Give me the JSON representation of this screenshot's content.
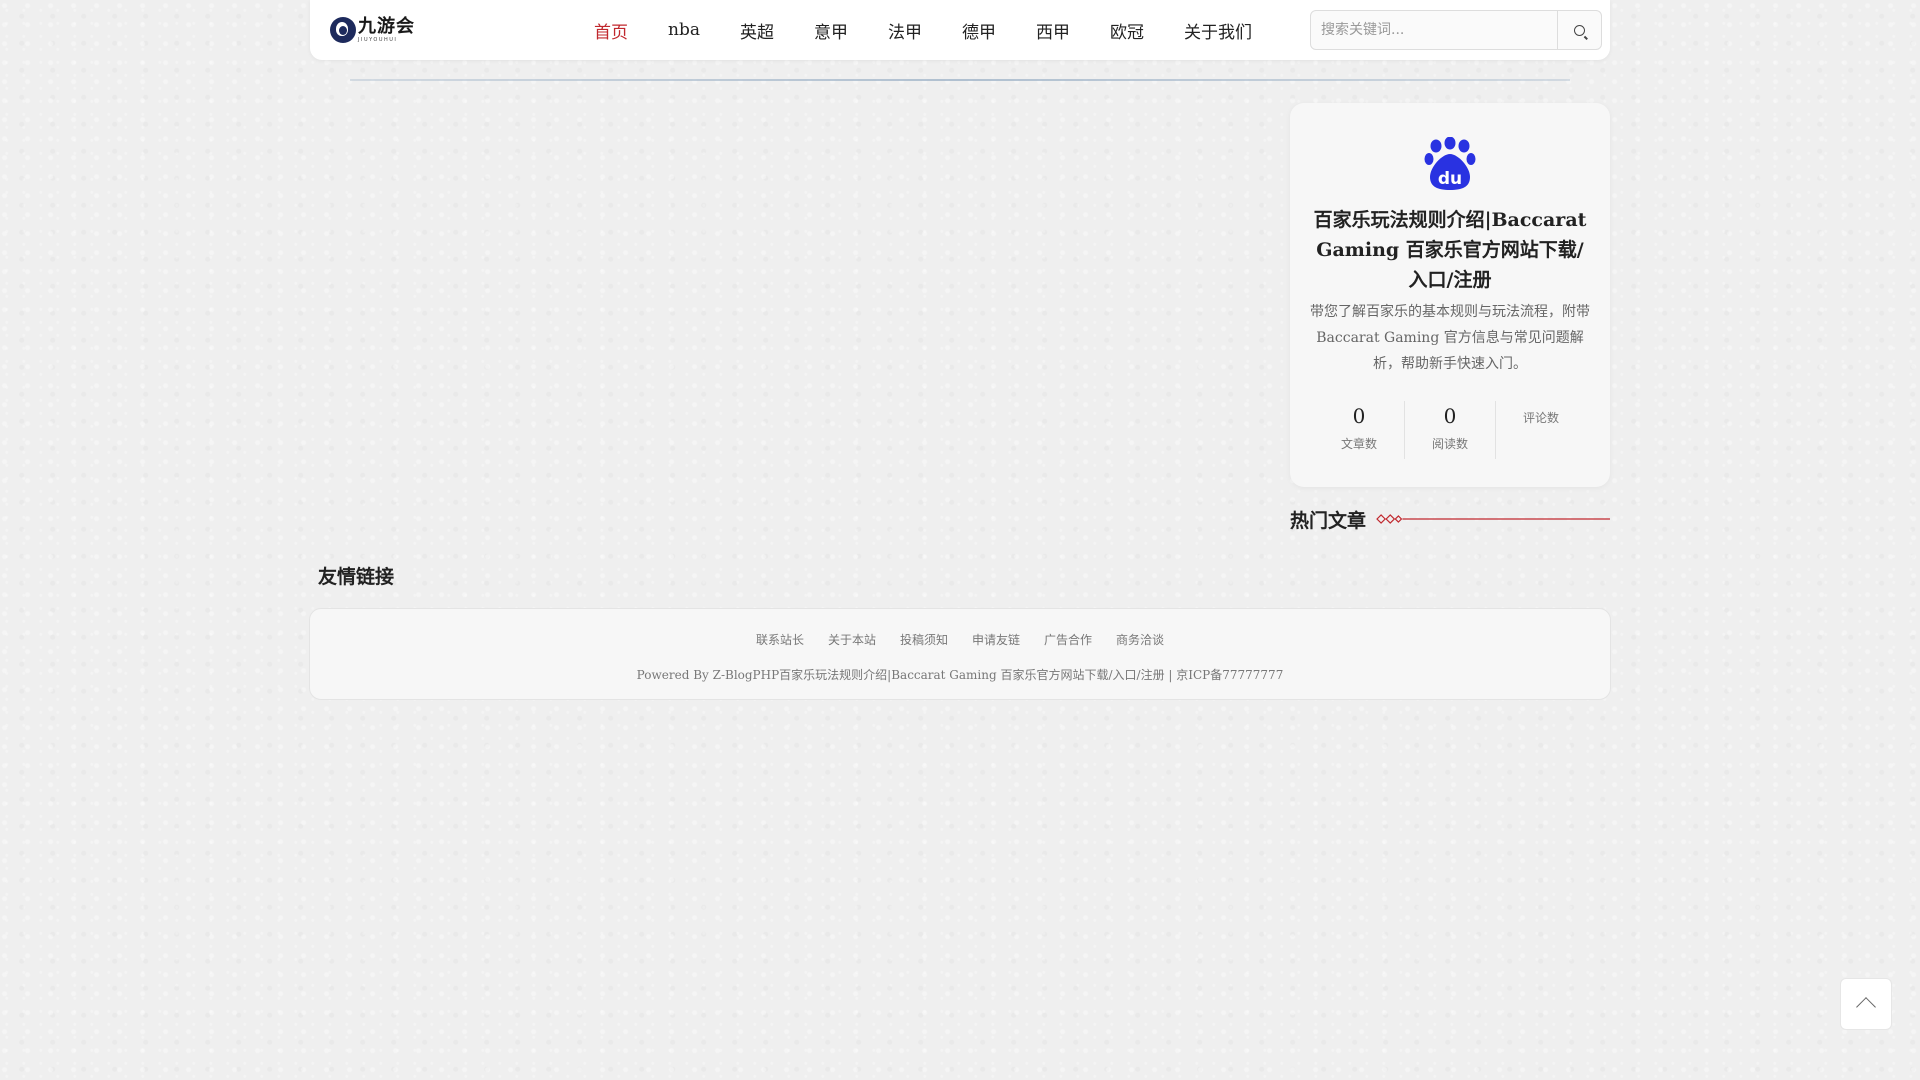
{
  "header": {
    "logo_cn": "九游会",
    "logo_en": "JIUYOUHUI",
    "nav": [
      {
        "label": "首页",
        "active": true
      },
      {
        "label": "nba"
      },
      {
        "label": "英超"
      },
      {
        "label": "意甲"
      },
      {
        "label": "法甲"
      },
      {
        "label": "德甲"
      },
      {
        "label": "西甲"
      },
      {
        "label": "欧冠"
      },
      {
        "label": "关于我们"
      }
    ],
    "search": {
      "placeholder": "搜索关键词...",
      "value": "",
      "icon": "search-icon"
    }
  },
  "profile": {
    "avatar_icon": "baidu-paw-icon",
    "avatar_color": "#2932e1",
    "title": "百家乐玩法规则介绍|Baccarat Gaming 百家乐官方网站下载/入口/注册",
    "description": "带您了解百家乐的基本规则与玩法流程，附带 Baccarat Gaming 官方信息与常见问题解析，帮助新手快速入门。",
    "stats": [
      {
        "value": "0",
        "label": "文章数"
      },
      {
        "value": "0",
        "label": "阅读数"
      },
      {
        "value": "",
        "label": "评论数"
      }
    ]
  },
  "hot_articles": {
    "title": "热门文章",
    "accent_color": "#c0272d"
  },
  "friend_links": {
    "title": "友情链接"
  },
  "footer": {
    "links": [
      "联系站长",
      "关于本站",
      "投稿须知",
      "申请友链",
      "广告合作",
      "商务洽谈"
    ],
    "copyright": "Powered By Z-BlogPHP百家乐玩法规则介绍|Baccarat Gaming 百家乐官方网站下载/入口/注册 | 京ICP备77777777"
  },
  "back_to_top": {
    "icon": "chevron-up-icon"
  }
}
